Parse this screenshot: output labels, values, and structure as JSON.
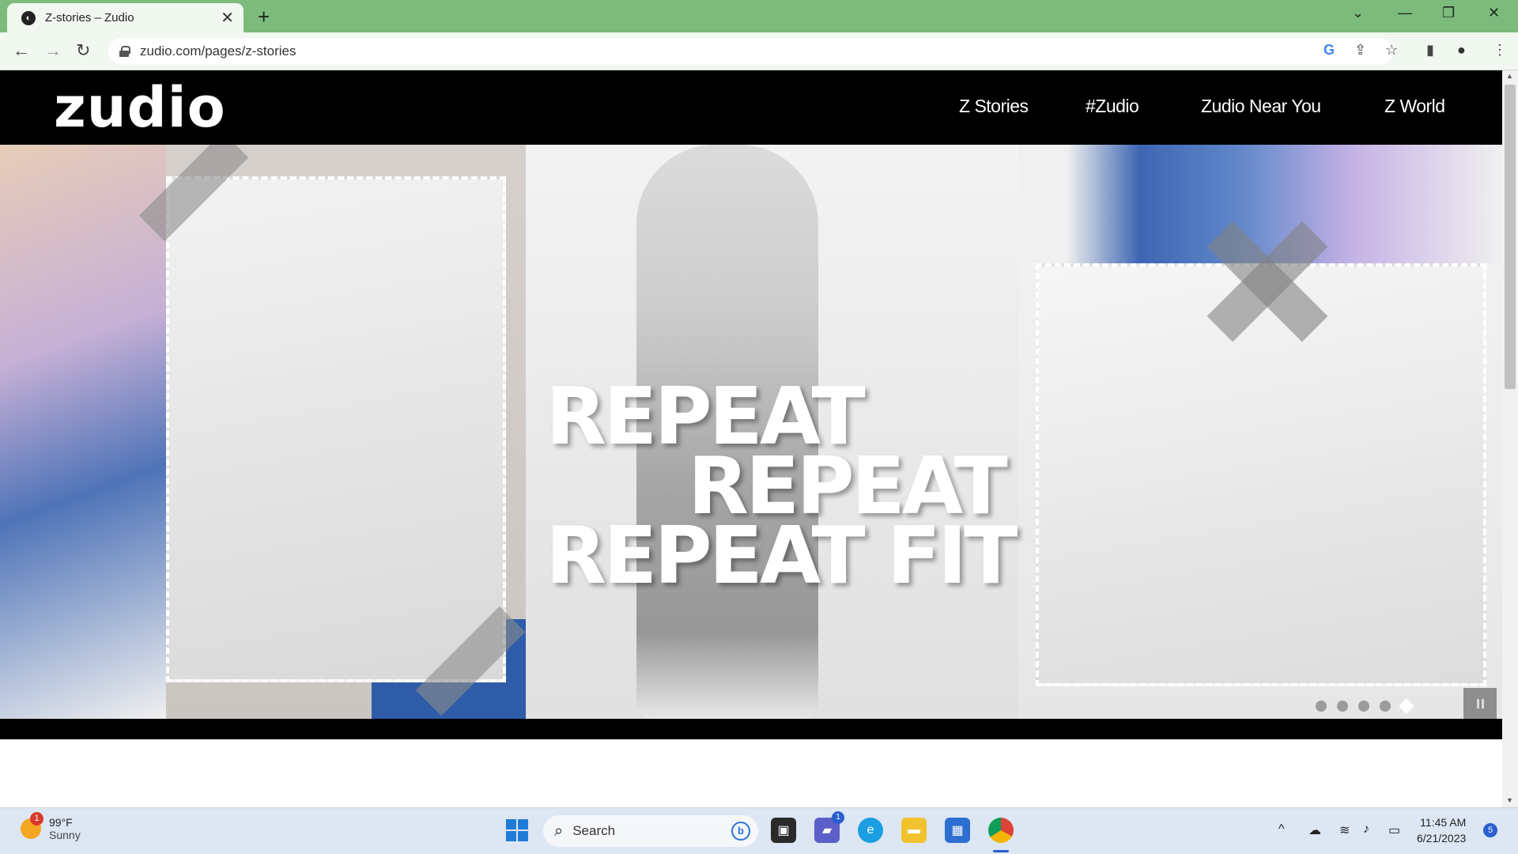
{
  "browser": {
    "tab_title": "Z-stories – Zudio",
    "tab_close": "✕",
    "new_tab": "+",
    "url": "zudio.com/pages/z-stories",
    "nav_back": "←",
    "nav_forward": "→",
    "nav_reload": "↻",
    "tab_search_icon": "⌄",
    "minimize": "—",
    "restore": "❐",
    "close": "✕",
    "google_icon": "G",
    "share_icon": "⇪",
    "star_icon": "☆",
    "sidepanel_icon": "▮",
    "profile_icon": "●",
    "menu_icon": "⋮"
  },
  "site": {
    "logo": "zudio",
    "nav": [
      "Z Stories",
      "#Zudio",
      "Zudio Near You",
      "Z World"
    ]
  },
  "hero": {
    "line1": "REPEAT",
    "line2": "REPEAT",
    "line3": "REPEAT FIT",
    "slides_total": 5,
    "active_slide": 5
  },
  "taskbar": {
    "weather_temp": "99°F",
    "weather_desc": "Sunny",
    "weather_badge": "1",
    "search_label": "Search",
    "teams_badge": "1",
    "time": "11:45 AM",
    "date": "6/21/2023",
    "notifications": "5",
    "tray_chevron": "^"
  },
  "colors": {
    "tabbar": "#7cbb7c",
    "site_header": "#000000",
    "accent_blue": "#2a5fcf"
  }
}
